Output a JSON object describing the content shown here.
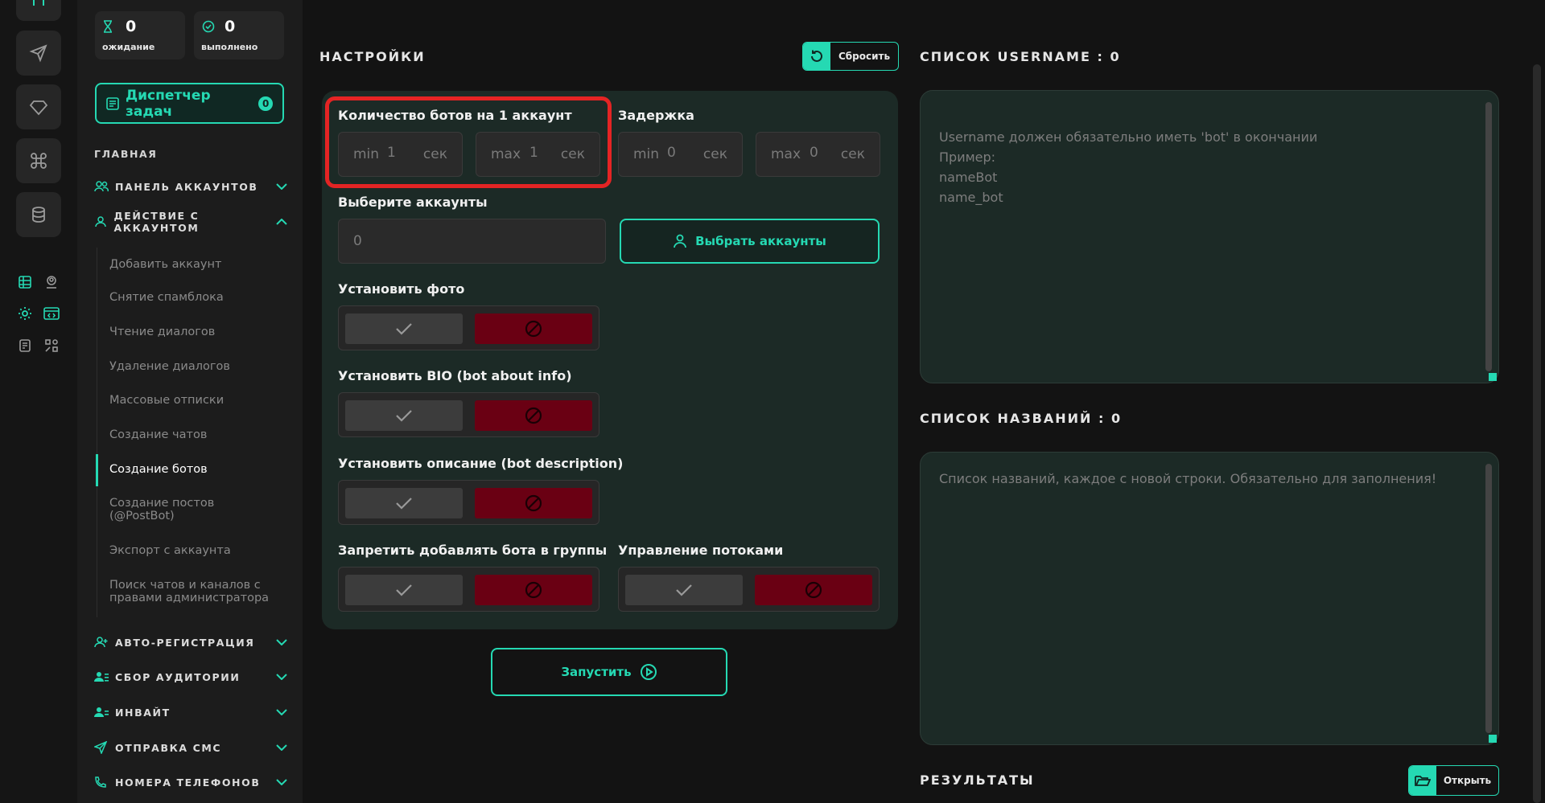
{
  "colors": {
    "accent": "#25d9b3",
    "danger": "#6a0013",
    "highlight": "#e32424"
  },
  "stats": [
    {
      "value": "0",
      "label": "ожидание",
      "icon": "hourglass-icon"
    },
    {
      "value": "0",
      "label": "выполнено",
      "icon": "check-circle-icon"
    }
  ],
  "task_manager": {
    "label": "Диспетчер задач",
    "count": "0"
  },
  "sidebar": {
    "section_title": "ГЛАВНАЯ",
    "groups": [
      {
        "label": "ПАНЕЛЬ АККАУНТОВ"
      },
      {
        "label": "ДЕЙСТВИЕ С АККАУНТОМ"
      },
      {
        "label": "АВТО-РЕГИСТРАЦИЯ"
      },
      {
        "label": "СБОР АУДИТОРИИ"
      },
      {
        "label": "ИНВАЙТ"
      },
      {
        "label": "ОТПРАВКА СМС"
      },
      {
        "label": "НОМЕРА ТЕЛЕФОНОВ"
      }
    ],
    "items": [
      "Добавить аккаунт",
      "Снятие спамблока",
      "Чтение диалогов",
      "Удаление диалогов",
      "Массовые отписки",
      "Создание чатов",
      "Создание ботов",
      "Создание постов\n(@PostBot)",
      "Экспорт с аккаунта",
      "Поиск чатов и каналов с правами администратора"
    ]
  },
  "settings": {
    "title": "НАСТРОЙКИ",
    "reset_label": "Сбросить",
    "bots_per_account": {
      "label": "Количество ботов на 1 аккаунт",
      "min_label": "min",
      "min_value": "1",
      "max_label": "max",
      "max_value": "1",
      "unit": "сек"
    },
    "delay": {
      "label": "Задержка",
      "min_label": "min",
      "min_value": "0",
      "max_label": "max",
      "max_value": "0",
      "unit": "сек"
    },
    "accounts": {
      "label": "Выберите аккаунты",
      "value": "0",
      "button": "Выбрать аккаунты"
    },
    "set_photo": {
      "label": "Установить фото"
    },
    "set_bio": {
      "label": "Установить BIO (bot about info)"
    },
    "set_description": {
      "label": "Установить описание (bot description)"
    },
    "deny_groups": {
      "label": "Запретить добавлять бота в группы"
    },
    "threads": {
      "label": "Управление потоками"
    },
    "run_label": "Запустить"
  },
  "usernames": {
    "title": "СПИСОК USERNAME : 0",
    "placeholder": "Username должен обязательно иметь 'bot' в окончании\nПример:\nnameBot\nname_bot"
  },
  "names": {
    "title": "СПИСОК НАЗВАНИЙ : 0",
    "placeholder": "Список названий, каждое с новой строки. Обязательно для заполнения!"
  },
  "results": {
    "title": "РЕЗУЛЬТАТЫ",
    "open_label": "Открыть"
  }
}
